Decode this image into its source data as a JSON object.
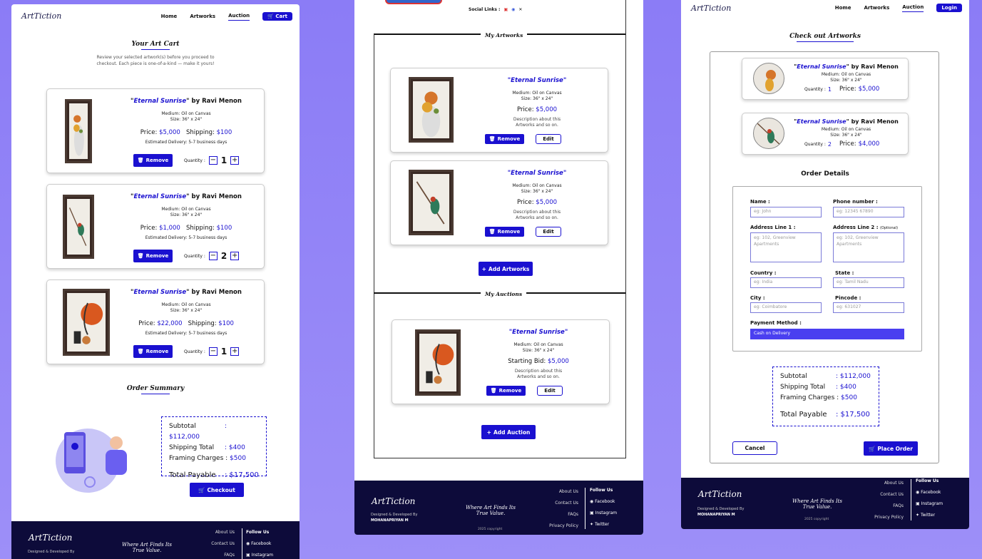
{
  "brand": "ArtTiction",
  "nav": {
    "home": "Home",
    "artworks": "Artworks",
    "auction": "Auction",
    "cart": "Cart",
    "login": "Login"
  },
  "cart": {
    "title": "Your Art Cart",
    "subtitle1": "Review your selected artwork(s) before you proceed to",
    "subtitle2": "checkout. Each piece is one-of-a-kind — make it yours!",
    "items": [
      {
        "title": "Eternal Sunrise",
        "by": "by Ravi Menon",
        "medium": "Medium: Oil on Canvas",
        "size": "Size: 36\" x 24\"",
        "price_label": "Price:",
        "price": "$5,000",
        "ship_label": "Shipping:",
        "ship": "$100",
        "delivery": "Estimated Delivery: 5-7 business days",
        "remove": "Remove",
        "qty_label": "Quantity :",
        "qty": "1"
      },
      {
        "title": "Eternal Sunrise",
        "by": "by Ravi Menon",
        "medium": "Medium: Oil on Canvas",
        "size": "Size: 36\" x 24\"",
        "price_label": "Price:",
        "price": "$1,000",
        "ship_label": "Shipping:",
        "ship": "$100",
        "delivery": "Estimated Delivery: 5-7 business days",
        "remove": "Remove",
        "qty_label": "Quantity :",
        "qty": "2"
      },
      {
        "title": "Eternal Sunrise",
        "by": "by Ravi Menon",
        "medium": "Medium: Oil on Canvas",
        "size": "Size: 36\" x 24\"",
        "price_label": "Price:",
        "price": "$22,000",
        "ship_label": "Shipping:",
        "ship": "$100",
        "delivery": "Estimated Delivery: 5-7 business days",
        "remove": "Remove",
        "qty_label": "Quantity :",
        "qty": "1"
      }
    ],
    "summary_title": "Order Summary",
    "summary": {
      "subtotal_l": "Subtotal",
      "subtotal": ": $112,000",
      "ship_l": "Shipping Total",
      "ship": ": $400",
      "frame_l": "Framing Charges :",
      "frame": "$500",
      "total_l": "Total Payable",
      "total": ": $17,500"
    },
    "checkout": "Checkout"
  },
  "profile": {
    "social": "Social Links :",
    "my_artworks": "My Artworks",
    "my_auctions": "My Auctions",
    "art_items": [
      {
        "title": "\"Eternal Sunrise\"",
        "medium": "Medium: Oil on Canvas",
        "size": "Size: 36\" x 24\"",
        "price_label": "Price:",
        "price": "$5,000",
        "desc1": "Description about this",
        "desc2": "Artworks and so on.",
        "remove": "Remove",
        "edit": "Edit"
      },
      {
        "title": "\"Eternal Sunrise\"",
        "medium": "Medium: Oil on Canvas",
        "size": "Size: 36\" x 24\"",
        "price_label": "Price:",
        "price": "$5,000",
        "desc1": "Description about this",
        "desc2": "Artworks and so on.",
        "remove": "Remove",
        "edit": "Edit"
      }
    ],
    "add_artworks": "Add Artworks",
    "auction_item": {
      "title": "\"Eternal Sunrise\"",
      "medium": "Medium: Oil on Canvas",
      "size": "Size: 36\" x 24\"",
      "bid_label": "Starting Bid:",
      "bid": "$5,000",
      "desc1": "Description about this",
      "desc2": "Artworks and so on.",
      "remove": "Remove",
      "edit": "Edit"
    },
    "add_auction": "Add Auction"
  },
  "checkout": {
    "title": "Check out Artworks",
    "items": [
      {
        "title": "Eternal Sunrise",
        "by": "by Ravi Menon",
        "medium": "Medium: Oil on Canvas",
        "size": "Size: 36\" x 24\"",
        "qty_label": "Quantity :",
        "qty": "1",
        "price_label": "Price:",
        "price": "$5,000"
      },
      {
        "title": "Eternal Sunrise",
        "by": "by Ravi Menon",
        "medium": "Medium: Oil on Canvas",
        "size": "Size: 36\" x 24\"",
        "qty_label": "Quantity :",
        "qty": "2",
        "price_label": "Price:",
        "price": "$4,000"
      }
    ],
    "order_details": "Order Details",
    "fields": {
      "name": "Name :",
      "name_ph": "eg: John",
      "phone": "Phone number :",
      "phone_ph": "eg: 12345 67890",
      "addr1": "Address Line 1 :",
      "addr1_ph": "eg: 102, Greenview Apartments",
      "addr2": "Address Line 2 :",
      "addr2_opt": "(Optional)",
      "addr2_ph": "eg: 102, Greenview Apartments",
      "country": "Country :",
      "country_ph": "eg: India",
      "state": "State :",
      "state_ph": "eg: Tamil Nadu",
      "city": "City :",
      "city_ph": "eg: Coimbatore",
      "pin": "Pincode :",
      "pin_ph": "eg: 631027",
      "payment": "Payment Method :",
      "payment_val": "Cash on Delivery"
    },
    "summary": {
      "subtotal_l": "Subtotal",
      "subtotal": ": $112,000",
      "ship_l": "Shipping Total",
      "ship": ": $400",
      "frame_l": "Framing Charges :",
      "frame": "$500",
      "total_l": "Total Payable",
      "total": ": $17,500"
    },
    "cancel": "Cancel",
    "place": "Place Order"
  },
  "footer": {
    "designed": "Designed & Developed By",
    "author": "MOHANAPRIYAN M",
    "tag1": "Where Art Finds Its",
    "tag2": "True Value.",
    "links": [
      "About Us",
      "Contact Us",
      "FAQs",
      "Privacy Policy"
    ],
    "follow": "Follow Us",
    "social": [
      "Facebook",
      "Instagram",
      "Twitter"
    ],
    "copy": "2025 copyright"
  }
}
